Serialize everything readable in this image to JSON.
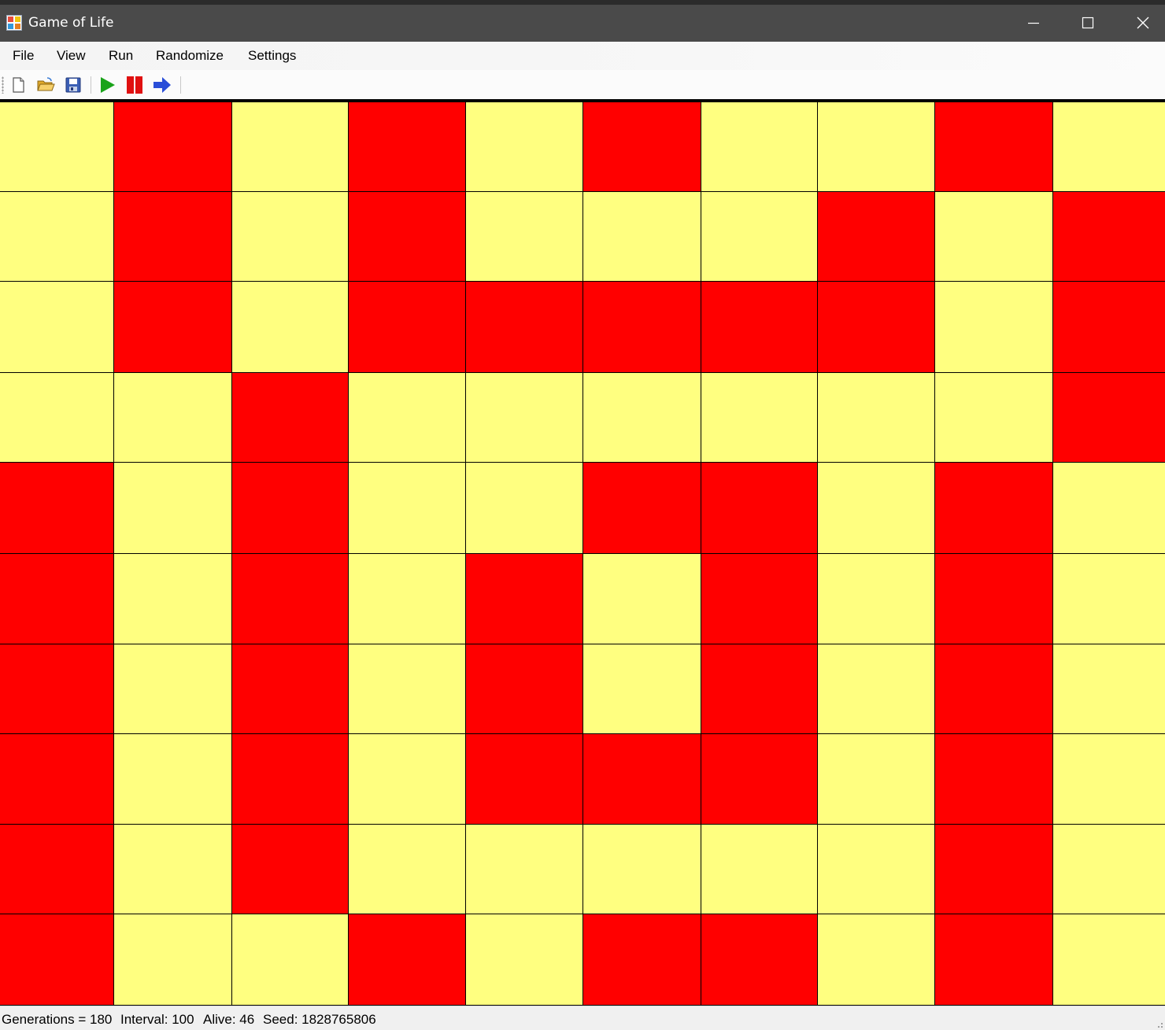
{
  "window": {
    "title": "Game of Life",
    "controls": {
      "minimize": "minimize-icon",
      "maximize": "maximize-icon",
      "close": "close-icon"
    }
  },
  "menu": {
    "items": [
      {
        "id": "file",
        "label": "File"
      },
      {
        "id": "view",
        "label": "View"
      },
      {
        "id": "run",
        "label": "Run"
      },
      {
        "id": "randomize",
        "label": "Randomize"
      },
      {
        "id": "settings",
        "label": "Settings"
      }
    ]
  },
  "toolbar": {
    "buttons": [
      {
        "id": "new",
        "icon": "new-file-icon"
      },
      {
        "id": "open",
        "icon": "open-folder-icon"
      },
      {
        "id": "save",
        "icon": "save-disk-icon"
      },
      {
        "id": "start",
        "icon": "play-icon"
      },
      {
        "id": "pause",
        "icon": "pause-icon"
      },
      {
        "id": "next",
        "icon": "next-arrow-icon"
      }
    ]
  },
  "board": {
    "rows": 10,
    "cols": 10,
    "colors": {
      "alive": "#ff0000",
      "dead": "#ffff80",
      "grid": "#000000"
    },
    "cells": [
      [
        0,
        1,
        0,
        1,
        0,
        1,
        0,
        0,
        1,
        0
      ],
      [
        0,
        1,
        0,
        1,
        0,
        0,
        0,
        1,
        0,
        1
      ],
      [
        0,
        1,
        0,
        1,
        1,
        1,
        1,
        1,
        0,
        1
      ],
      [
        0,
        0,
        1,
        0,
        0,
        0,
        0,
        0,
        0,
        1
      ],
      [
        1,
        0,
        1,
        0,
        0,
        1,
        1,
        0,
        1,
        0
      ],
      [
        1,
        0,
        1,
        0,
        1,
        0,
        1,
        0,
        1,
        0
      ],
      [
        1,
        0,
        1,
        0,
        1,
        0,
        1,
        0,
        1,
        0
      ],
      [
        1,
        0,
        1,
        0,
        1,
        1,
        1,
        0,
        1,
        0
      ],
      [
        1,
        0,
        1,
        0,
        0,
        0,
        0,
        0,
        1,
        0
      ],
      [
        1,
        0,
        0,
        1,
        0,
        1,
        1,
        0,
        1,
        0
      ]
    ]
  },
  "status": {
    "generations": "Generations = 180",
    "interval": "Interval: 100",
    "alive": "Alive: 46",
    "seed": "Seed: 1828765806"
  }
}
